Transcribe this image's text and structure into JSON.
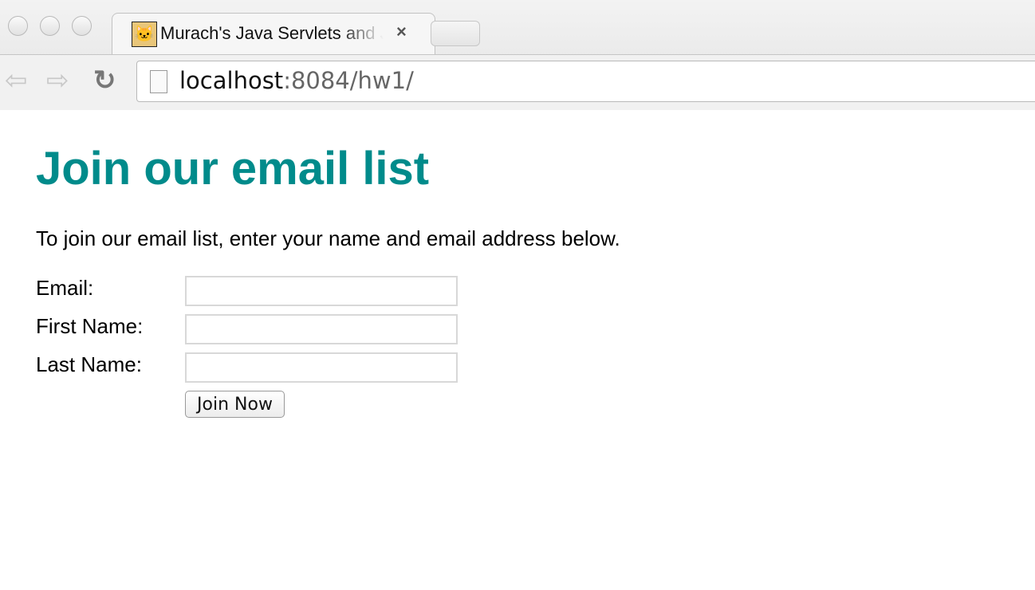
{
  "browser": {
    "tab_title": "Murach's Java Servlets and JSP",
    "tab_icon": "tomcat-icon",
    "close_icon": "×",
    "url_host": "localhost",
    "url_rest": ":8084/hw1/",
    "back_icon": "⇦",
    "forward_icon": "⇨",
    "reload_icon": "↻"
  },
  "page": {
    "heading": "Join our email list",
    "intro": "To join our email list, enter your name and email address below.",
    "heading_color": "#008b8b",
    "form": {
      "email_label": "Email:",
      "email_value": "",
      "first_name_label": "First Name:",
      "first_name_value": "",
      "last_name_label": "Last Name:",
      "last_name_value": "",
      "submit_label": "Join Now"
    }
  }
}
